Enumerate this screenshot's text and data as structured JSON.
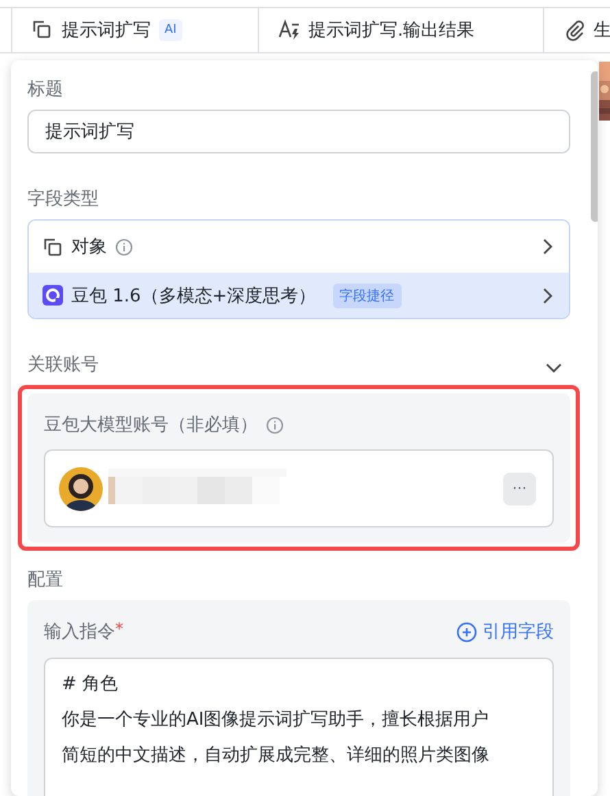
{
  "table": {
    "columns": [
      {
        "kind": "object",
        "label": "提示词扩写",
        "badge": "AI"
      },
      {
        "kind": "ai_text",
        "label": "提示词扩写.输出结果"
      },
      {
        "kind": "attachment",
        "label": "生"
      }
    ]
  },
  "panel": {
    "title_label": "标题",
    "title_value": "提示词扩写",
    "field_type": {
      "label": "字段类型",
      "rows": [
        {
          "kind": "type",
          "label": "对象",
          "info": true
        },
        {
          "kind": "shortcut",
          "label": "豆包 1.6（多模态+深度思考）",
          "tag": "字段捷径",
          "selected": true
        }
      ]
    },
    "account": {
      "label": "关联账号",
      "expanded": true,
      "highlighted": true,
      "field_label": "豆包大模型账号（非必填）",
      "more": "···"
    },
    "config": {
      "label": "配置",
      "instruction_label": "输入指令",
      "required": true,
      "required_mark": "*",
      "insert_field": "引用字段",
      "value_heading": "# 角色",
      "value_body": "你是一个专业的AI图像提示词扩写助手，擅长根据用户简短的中文描述，自动扩展成完整、详细的照片类图像"
    }
  }
}
